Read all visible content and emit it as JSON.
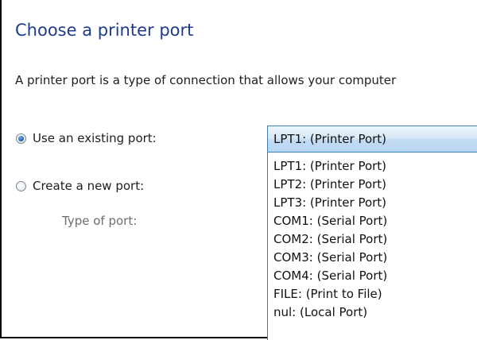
{
  "page": {
    "title": "Choose a printer port",
    "description": "A printer port is a type of connection that allows your computer"
  },
  "options": {
    "existing_label": "Use an existing port:",
    "existing_selected": true,
    "new_label": "Create a new port:",
    "new_selected": false,
    "type_of_port_label": "Type of port:"
  },
  "port_combo": {
    "selected": "LPT1: (Printer Port)",
    "items": [
      "LPT1: (Printer Port)",
      "LPT2: (Printer Port)",
      "LPT3: (Printer Port)",
      "COM1: (Serial Port)",
      "COM2: (Serial Port)",
      "COM3: (Serial Port)",
      "COM4: (Serial Port)",
      "FILE: (Print to File)",
      "nul: (Local Port)"
    ]
  },
  "colors": {
    "title": "#1f3b8e",
    "selection_highlight": "#c1dbf2",
    "muted_label": "#6d6d6d"
  }
}
